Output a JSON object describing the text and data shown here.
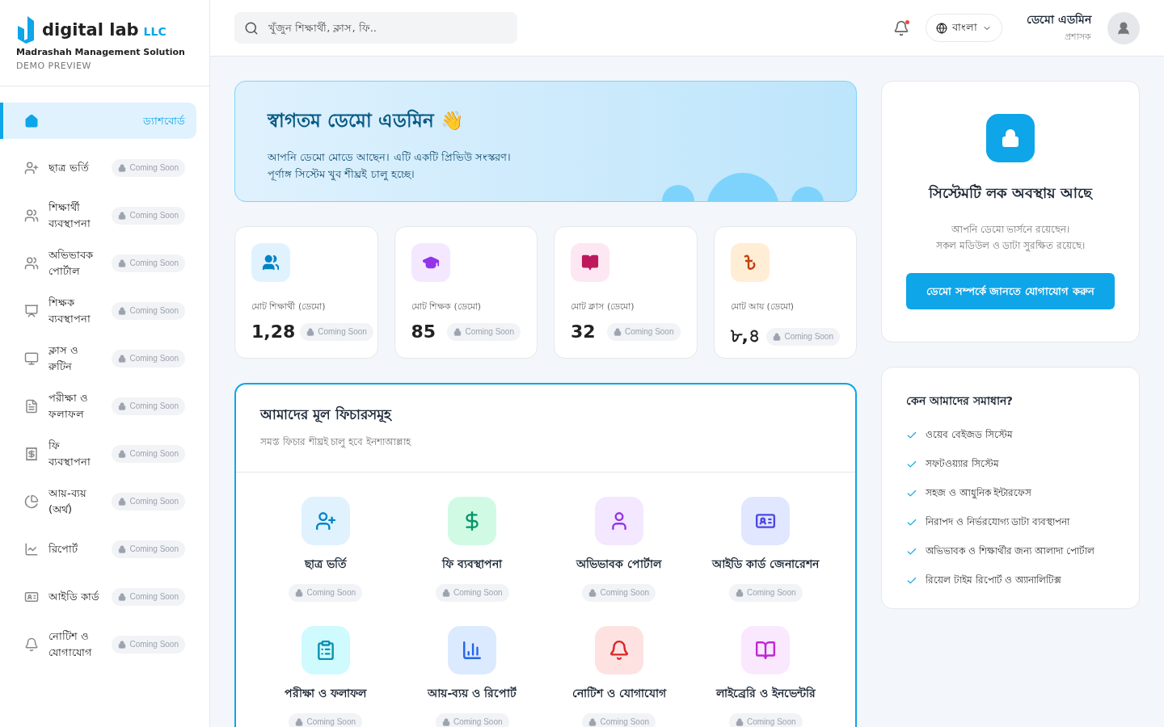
{
  "brand": {
    "name": "digital lab",
    "suffix": "LLC",
    "tagline": "Madrashah Management Solution",
    "mode": "DEMO PREVIEW"
  },
  "sidebar": {
    "items": [
      {
        "label": "ড্যাশবোর্ড",
        "selected": true
      },
      {
        "label": "ছাত্র ভর্তি",
        "selected": false,
        "badge": "Coming Soon"
      },
      {
        "label": "শিক্ষার্থী ব্যবস্থাপনা",
        "selected": false,
        "badge": "Coming Soon"
      },
      {
        "label": "অভিভাবক পোর্টাল",
        "selected": false,
        "badge": "Coming Soon"
      },
      {
        "label": "শিক্ষক ব্যবস্থাপনা",
        "selected": false,
        "badge": "Coming Soon"
      },
      {
        "label": "ক্লাস ও রুটিন",
        "selected": false,
        "badge": "Coming Soon"
      },
      {
        "label": "পরীক্ষা ও ফলাফল",
        "selected": false,
        "badge": "Coming Soon"
      },
      {
        "label": "ফি ব্যবস্থাপনা",
        "selected": false,
        "badge": "Coming Soon"
      },
      {
        "label": "আয়-ব্যয় (অর্থ)",
        "selected": false,
        "badge": "Coming Soon"
      },
      {
        "label": "রিপোর্ট",
        "selected": false,
        "badge": "Coming Soon"
      },
      {
        "label": "আইডি কার্ড",
        "selected": false,
        "badge": "Coming Soon"
      },
      {
        "label": "নোটিশ ও যোগাযোগ",
        "selected": false,
        "badge": "Coming Soon"
      }
    ]
  },
  "header": {
    "search": {
      "placeholder": "খুঁজুন শিক্ষার্থী, ক্লাস, ফি.."
    },
    "notification_dot": true,
    "language": "বাংলা",
    "user": {
      "name": "ডেমো এডমিন",
      "role": "প্রশাসক"
    }
  },
  "welcome": {
    "title": "স্বাগতম ডেমো এডমিন 👋",
    "lines": [
      "আপনি ডেমো মোডে আছেন। এটি একটি প্রিভিউ সংস্করণ।",
      "পূর্ণাঙ্গ সিস্টেম খুব শীঘ্রই চালু হচ্ছে।"
    ]
  },
  "stats": [
    {
      "label": "মোট শিক্ষার্থী (ডেমো)",
      "value": "1,28",
      "badge": "Coming Soon"
    },
    {
      "label": "মোট শিক্ষক (ডেমো)",
      "value": "85",
      "badge": "Coming Soon"
    },
    {
      "label": "মোট ক্লাস (ডেমো)",
      "value": "32",
      "badge": "Coming Soon"
    },
    {
      "label": "মোট আয় (ডেমো)",
      "value": "৮,৪",
      "badge": "Coming Soon"
    }
  ],
  "features": {
    "title": "আমাদের মূল ফিচারসমূহ",
    "subtitle": "সমস্ত ফিচার শীঘ্রই চালু হবে ইনশাআল্লাহ",
    "items": [
      {
        "label": "ছাত্র ভর্তি",
        "badge": "Coming Soon"
      },
      {
        "label": "ফি ব্যবস্থাপনা",
        "badge": "Coming Soon"
      },
      {
        "label": "অভিভাবক পোর্টাল",
        "badge": "Coming Soon"
      },
      {
        "label": "আইডি কার্ড জেনারেশন",
        "badge": "Coming Soon"
      },
      {
        "label": "পরীক্ষা ও ফলাফল",
        "badge": "Coming Soon"
      },
      {
        "label": "আয়-ব্যয় ও রিপোর্ট",
        "badge": "Coming Soon"
      },
      {
        "label": "নোটিশ ও যোগাযোগ",
        "badge": "Coming Soon"
      },
      {
        "label": "লাইব্রেরি ও ইনভেন্টরি",
        "badge": "Coming Soon"
      }
    ]
  },
  "lock_card": {
    "title": "সিস্টেমটি লক অবস্থায় আছে",
    "lines": [
      "আপনি ডেমো ভার্সনে রয়েছেন।",
      "সকল মডিউল ও ডাটা সুরক্ষিত রয়েছে।"
    ],
    "button": "ডেমো সম্পর্কে জানতে যোগাযোগ করুন"
  },
  "why_card": {
    "title": "কেন আমাদের সমাধান?",
    "items": [
      "ওয়েব বেইজড সিস্টেম",
      "সফটওয়্যার সিস্টেম",
      "সহজ ও আধুনিক ইন্টারফেস",
      "নিরাপদ ও নির্ভরযোগ্য ডাটা ব্যবস্থাপনা",
      "অভিভাবক ও শিক্ষার্থীর জন্য আলাদা পোর্টাল",
      "রিয়েল টাইম রিপোর্ট ও অ্যানালিটিক্স"
    ]
  }
}
